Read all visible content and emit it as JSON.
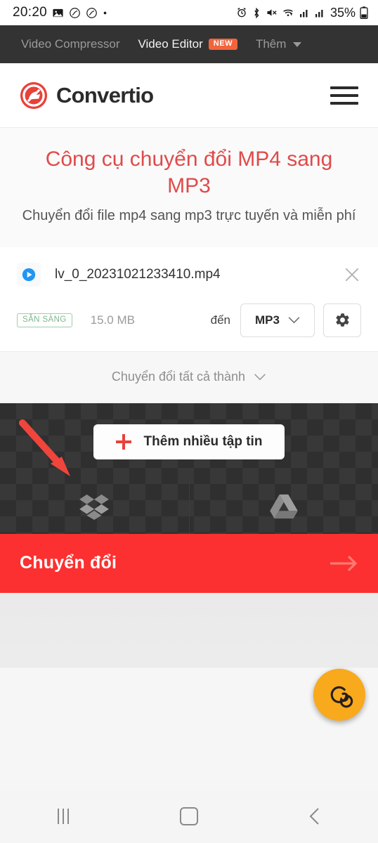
{
  "status_bar": {
    "time": "20:20",
    "battery_percent": "35%",
    "left_icons": [
      "gallery-icon",
      "dnd-icon",
      "dnd-secondary-icon",
      "dot-indicator"
    ],
    "right_icons": [
      "alarm-icon",
      "bluetooth-icon",
      "mute-icon",
      "wifi-icon",
      "signal-sim1-icon",
      "signal-sim2-icon",
      "battery-icon"
    ]
  },
  "topnav": {
    "items": [
      {
        "label": "Video Compressor",
        "active": false,
        "badge": ""
      },
      {
        "label": "Video Editor",
        "active": true,
        "badge": "NEW"
      },
      {
        "label": "Thêm",
        "active": false,
        "badge": ""
      }
    ]
  },
  "header": {
    "brand": "Convertio",
    "logo_icon": "convertio-logo-icon",
    "menu_icon": "hamburger-menu-icon"
  },
  "hero": {
    "title": "Công cụ chuyển đổi MP4 sang MP3",
    "subtitle": "Chuyển đổi file mp4 sang mp3 trực tuyến và miễn phí"
  },
  "file": {
    "type_icon": "video-play-icon",
    "name": "lv_0_20231021233410.mp4",
    "remove_icon": "close-x-icon",
    "status_badge": "SẴN SÀNG",
    "size": "15.0 MB",
    "to_label": "đến",
    "format": "MP3",
    "format_caret_icon": "chevron-down-icon",
    "settings_icon": "gear-icon"
  },
  "convert_all": {
    "label": "Chuyển đổi tất cả thành",
    "caret_icon": "chevron-down-icon"
  },
  "drop_area": {
    "add_files_label": "Thêm nhiều tập tin",
    "add_icon": "plus-icon",
    "cloud_sources": [
      {
        "name": "dropbox-icon"
      },
      {
        "name": "google-drive-icon"
      }
    ],
    "annotation": "red-arrow-annotation"
  },
  "convert_button": {
    "label": "Chuyển đổi",
    "arrow_icon": "arrow-right-icon"
  },
  "fab": {
    "icon": "spiral-icon"
  },
  "android_nav": {
    "buttons": [
      {
        "name": "recents-button",
        "icon": "recents-icon"
      },
      {
        "name": "home-button",
        "icon": "home-icon"
      },
      {
        "name": "back-button",
        "icon": "back-chevron-icon"
      }
    ]
  },
  "colors": {
    "brand_red": "#e8413a",
    "convert_red": "#fc3030",
    "hero_red": "#e04a4a",
    "new_badge_orange": "#f2643c",
    "ready_green": "#7cb889",
    "fab_orange": "#f8a91c",
    "dark_nav": "#333333",
    "drop_dark": "#2f2f2f"
  }
}
